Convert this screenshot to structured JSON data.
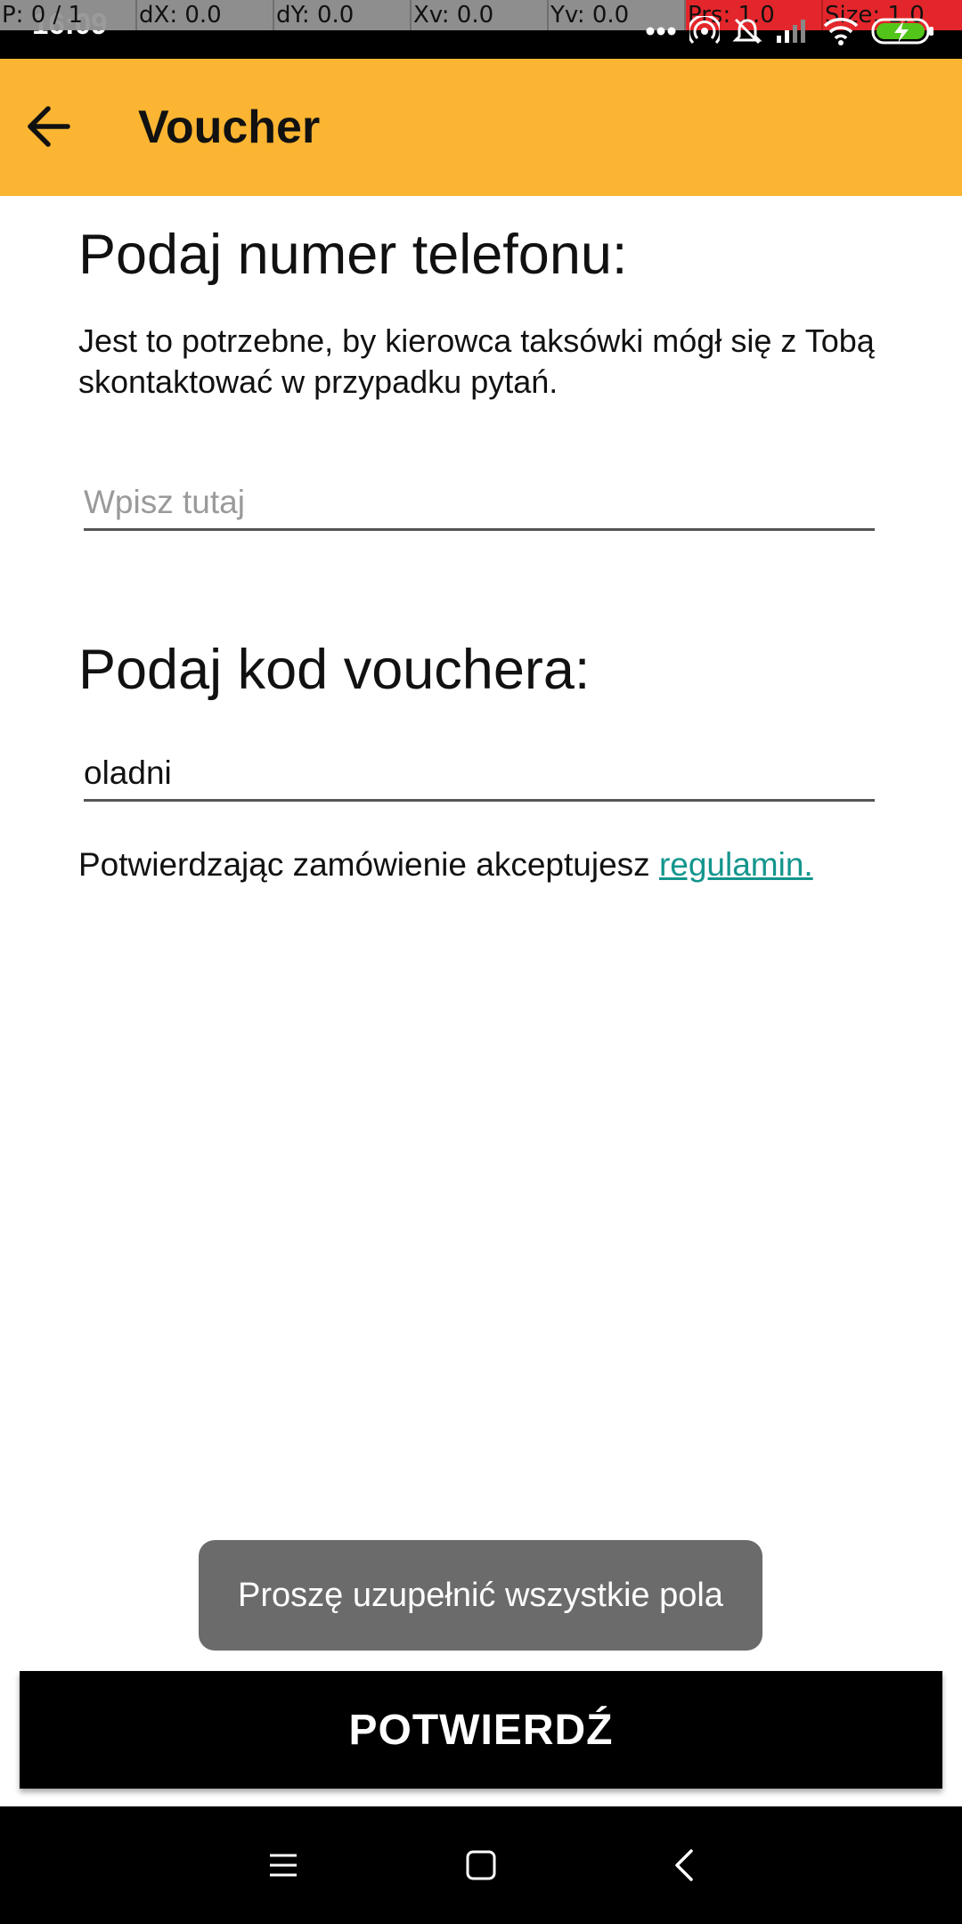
{
  "status_bar": {
    "time": "16:09",
    "debug": {
      "pointer": "P: 0 / 1",
      "dx": "dX: 0.0",
      "dy": "dY: 0.0",
      "xv": "Xv: 0.0",
      "yv": "Yv: 0.0",
      "pressure": "Prs: 1.0",
      "size": "Size: 1.0"
    },
    "icons": [
      "more-dots-icon",
      "hotspot-icon",
      "alarm-icon",
      "signal-icon",
      "wifi-icon",
      "battery-charging-icon"
    ]
  },
  "app_bar": {
    "title": "Voucher",
    "back_icon": "arrow-back-icon",
    "background_color": "#fbb532"
  },
  "phone_section": {
    "heading": "Podaj numer telefonu:",
    "description": "Jest to potrzebne, by kierowca taksówki mógł się z Tobą skontaktować w przypadku pytań.",
    "input_value": "",
    "input_placeholder": "Wpisz tutaj"
  },
  "voucher_section": {
    "heading": "Podaj kod vouchera:",
    "input_value": "oladni",
    "input_placeholder": ""
  },
  "terms": {
    "text": "Potwierdzając zamówienie akceptujesz ",
    "link_label": "regulamin.",
    "link_color": "#13958d"
  },
  "toast": {
    "message": "Proszę uzupełnić wszystkie pola"
  },
  "confirm_button": {
    "label": "POTWIERDŹ"
  },
  "nav_bar": {
    "icons": [
      "menu-icon",
      "home-square-icon",
      "back-chevron-icon"
    ]
  }
}
